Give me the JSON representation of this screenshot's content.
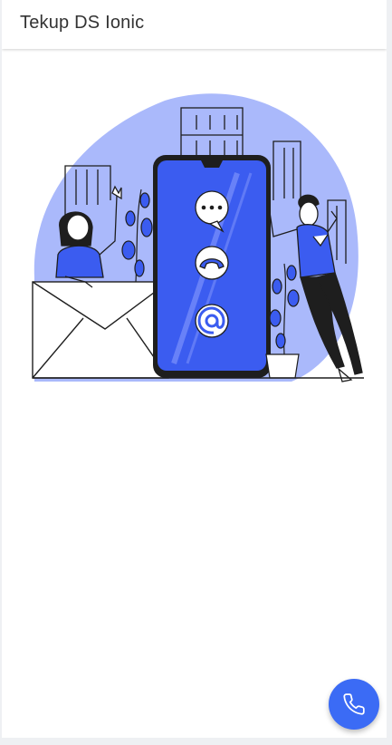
{
  "toolbar": {
    "title": "Tekup DS Ionic"
  },
  "illustration": {
    "icons": [
      "chat-bubble-icon",
      "phone-icon",
      "at-sign-icon"
    ],
    "accent_color": "#3b5cf0",
    "blob_color": "#aab9fb"
  },
  "fab": {
    "icon": "phone-icon",
    "color": "#3b6bf5"
  }
}
